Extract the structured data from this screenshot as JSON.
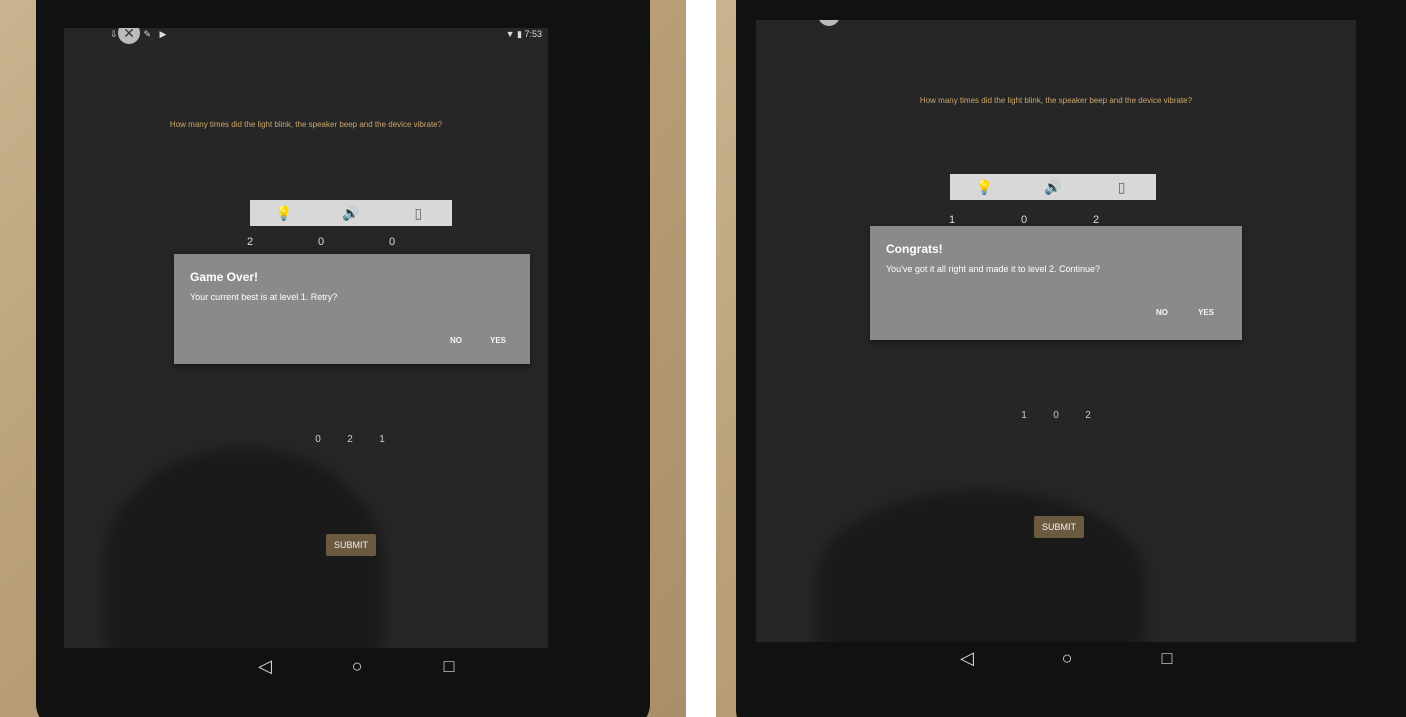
{
  "left_screen": {
    "status": {
      "left_icons": "⇩ ▲ ✎ ▶",
      "time": "▼ ▮ 7:53"
    },
    "question": "How many times did the light blink, the speaker beep and the device vibrate?",
    "sensor_icons": [
      "light-bulb-icon",
      "speaker-icon",
      "vibrate-icon"
    ],
    "counts": [
      "2",
      "0",
      "0"
    ],
    "dialog": {
      "title": "Game Over!",
      "message": "Your current best is at level 1. Retry?",
      "no": "NO",
      "yes": "YES"
    },
    "answers": [
      "0",
      "2",
      "1"
    ],
    "submit": "SUBMIT"
  },
  "right_screen": {
    "question": "How many times did the light blink, the speaker beep and the device vibrate?",
    "sensor_icons": [
      "light-bulb-icon",
      "speaker-icon",
      "vibrate-icon"
    ],
    "counts": [
      "1",
      "0",
      "2"
    ],
    "dialog": {
      "title": "Congrats!",
      "message": "You've got it all right and made it to level 2. Continue?",
      "no": "NO",
      "yes": "YES"
    },
    "answers": [
      "1",
      "0",
      "2"
    ],
    "submit": "SUBMIT"
  },
  "nav": {
    "back": "◁",
    "home": "○",
    "recents": "□"
  },
  "icons": {
    "close": "✕",
    "bulb": "💡",
    "speaker": "🔊",
    "vibrate": "▯"
  }
}
